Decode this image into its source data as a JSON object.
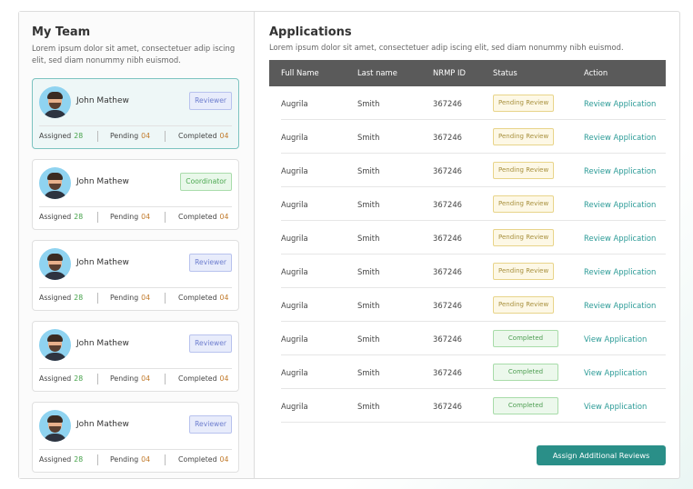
{
  "team": {
    "title": "My Team",
    "description": "Lorem ipsum dolor sit amet, consectetuer adip iscing elit, sed diam nonummy nibh euismod.",
    "assigned_label": "Assigned",
    "pending_label": "Pending",
    "completed_label": "Completed",
    "members": [
      {
        "name": "John Mathew",
        "role": "Reviewer",
        "assigned": "28",
        "pending": "04",
        "completed": "04"
      },
      {
        "name": "John Mathew",
        "role": "Coordinator",
        "assigned": "28",
        "pending": "04",
        "completed": "04"
      },
      {
        "name": "John Mathew",
        "role": "Reviewer",
        "assigned": "28",
        "pending": "04",
        "completed": "04"
      },
      {
        "name": "John Mathew",
        "role": "Reviewer",
        "assigned": "28",
        "pending": "04",
        "completed": "04"
      },
      {
        "name": "John Mathew",
        "role": "Reviewer",
        "assigned": "28",
        "pending": "04",
        "completed": "04"
      }
    ]
  },
  "applications": {
    "title": "Applications",
    "description": "Lorem ipsum dolor sit amet, consectetuer adip iscing elit, sed diam nonummy nibh euismod.",
    "columns": [
      "Full Name",
      "Last name",
      "NRMP ID",
      "Status",
      "Action"
    ],
    "rows": [
      {
        "first": "Augrila",
        "last": "Smith",
        "id": "367246",
        "status": "Pending Review",
        "action": "Review Application"
      },
      {
        "first": "Augrila",
        "last": "Smith",
        "id": "367246",
        "status": "Pending Review",
        "action": "Review Application"
      },
      {
        "first": "Augrila",
        "last": "Smith",
        "id": "367246",
        "status": "Pending Review",
        "action": "Review Application"
      },
      {
        "first": "Augrila",
        "last": "Smith",
        "id": "367246",
        "status": "Pending Review",
        "action": "Review Application"
      },
      {
        "first": "Augrila",
        "last": "Smith",
        "id": "367246",
        "status": "Pending Review",
        "action": "Review Application"
      },
      {
        "first": "Augrila",
        "last": "Smith",
        "id": "367246",
        "status": "Pending Review",
        "action": "Review Application"
      },
      {
        "first": "Augrila",
        "last": "Smith",
        "id": "367246",
        "status": "Pending Review",
        "action": "Review Application"
      },
      {
        "first": "Augrila",
        "last": "Smith",
        "id": "367246",
        "status": "Completed",
        "action": "View Application"
      },
      {
        "first": "Augrila",
        "last": "Smith",
        "id": "367246",
        "status": "Completed",
        "action": "View Application"
      },
      {
        "first": "Augrila",
        "last": "Smith",
        "id": "367246",
        "status": "Completed",
        "action": "View Application"
      }
    ],
    "assign_button": "Assign Additional Reviews"
  },
  "colors": {
    "accent": "#2a8f88",
    "header_bg": "#5a5a5a",
    "pending": "#a8903d",
    "completed": "#4e9e52"
  }
}
